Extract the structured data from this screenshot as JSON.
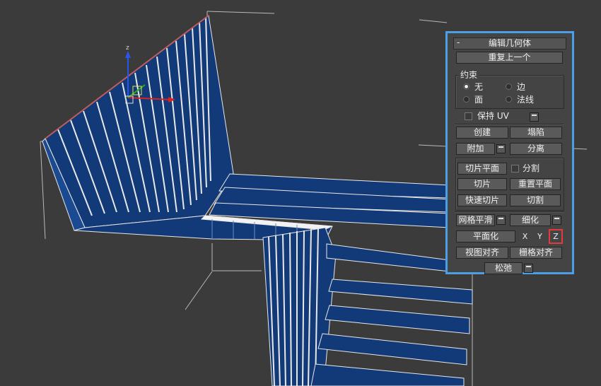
{
  "panel": {
    "rollout": {
      "collapse_symbol": "-",
      "title": "编辑几何体"
    },
    "repeat_last": "重复上一个",
    "constraints": {
      "label": "约束",
      "options": [
        {
          "label": "无",
          "selected": true
        },
        {
          "label": "边",
          "selected": false
        },
        {
          "label": "面",
          "selected": false
        },
        {
          "label": "法线",
          "selected": false
        }
      ]
    },
    "preserve_uv": {
      "label": "保持 UV",
      "checked": false
    },
    "create": "创建",
    "collapse": "塌陷",
    "attach": "附加",
    "detach": "分离",
    "slice_plane": "切片平面",
    "split": {
      "label": "分割",
      "checked": false
    },
    "slice": "切片",
    "reset_plane": "重置平面",
    "quickslice": "快速切片",
    "cut": "切割",
    "meshsmooth": "网格平滑",
    "tessellate": "细化",
    "make_planar": "平面化",
    "axes": {
      "x": "X",
      "y": "Y",
      "z": "Z",
      "highlighted": "Z"
    },
    "view_align": "视图对齐",
    "grid_align": "栅格对齐",
    "relax": "松弛"
  },
  "viewport": {
    "gizmo_axis_label": "z",
    "colors": {
      "background": "#3b3b3b",
      "mesh_blue": "#123a78",
      "edge_white": "#e8e8e8",
      "panel_border": "#4a9fe6",
      "highlight_red": "#e23b3b"
    }
  }
}
